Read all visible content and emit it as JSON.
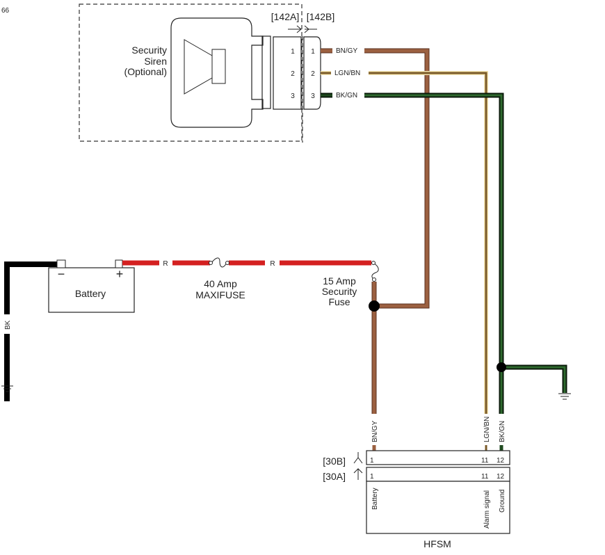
{
  "page_number": "66",
  "siren": {
    "label_lines": [
      "Security",
      "Siren",
      "(Optional)"
    ],
    "connector_a": "[142A]",
    "connector_b": "[142B]",
    "pins": [
      "1",
      "2",
      "3"
    ]
  },
  "siren_wires": [
    {
      "pin": "1",
      "code": "BN/GY",
      "color": "#9b6040"
    },
    {
      "pin": "2",
      "code": "LGN/BN",
      "color": "#7a5a28"
    },
    {
      "pin": "3",
      "code": "BK/GN",
      "color": "#1f4a1f"
    }
  ],
  "battery": {
    "label": "Battery",
    "negative": "−",
    "positive": "+",
    "ground_wire_code": "BK"
  },
  "power_wire": {
    "code": "R",
    "color": "#d42020"
  },
  "maxifuse": {
    "label_lines": [
      "40 Amp",
      "MAXIFUSE"
    ]
  },
  "security_fuse": {
    "label_lines": [
      "15 Amp",
      "Security",
      "Fuse"
    ]
  },
  "hfsm": {
    "title": "HFSM",
    "connector_b": "[30B]",
    "connector_a": "[30A]",
    "pins": [
      {
        "pin": "1",
        "wire": "BN/GY",
        "function": "Battery"
      },
      {
        "pin": "11",
        "wire": "LGN/BN",
        "function": "Alarm signal"
      },
      {
        "pin": "12",
        "wire": "BK/GN",
        "function": "Ground"
      }
    ]
  },
  "colors": {
    "bk": "#000000",
    "bn_gy": "#9b6040",
    "lgn_bn": "#7a5a28",
    "bk_gn": "#1f4a1f",
    "red": "#d42020"
  }
}
